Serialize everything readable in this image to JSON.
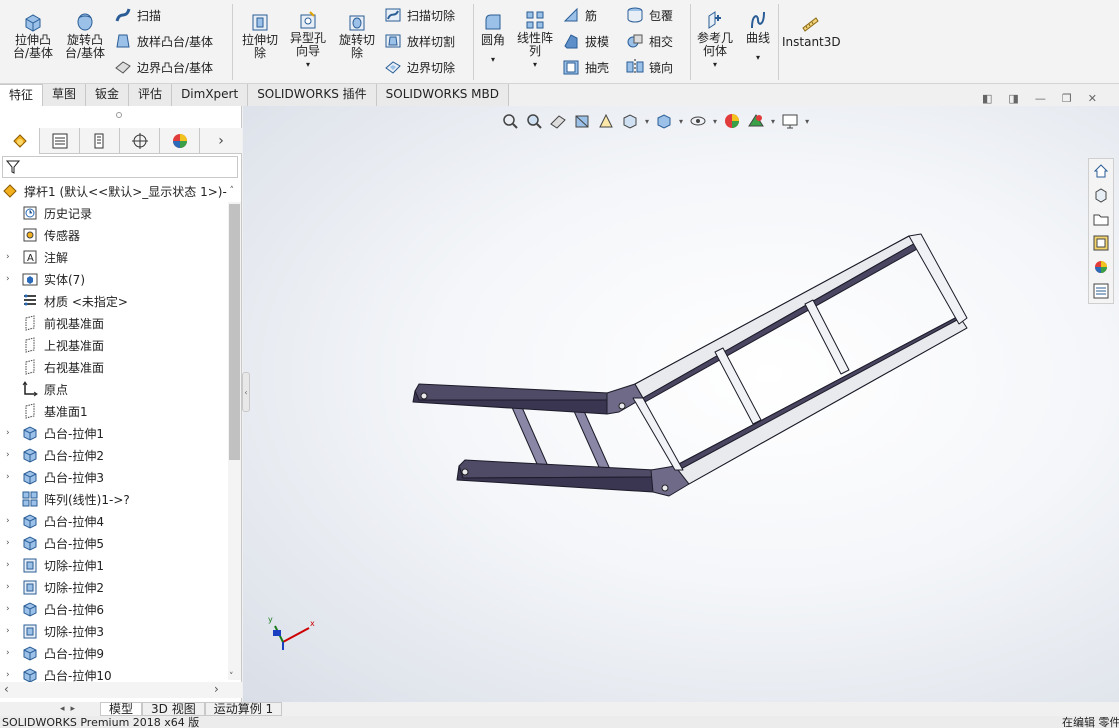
{
  "ribbon": {
    "extrude_boss": "拉伸凸\n台/基体",
    "revolve_boss": "旋转凸\n台/基体",
    "sweep": "扫描",
    "loft_boss": "放样凸台/基体",
    "boundary_boss": "边界凸台/基体",
    "extrude_cut": "拉伸切\n除",
    "hole_wizard": "异型孔\n向导",
    "revolve_cut": "旋转切\n除",
    "sweep_cut": "扫描切除",
    "loft_cut": "放样切割",
    "boundary_cut": "边界切除",
    "fillet": "圆角",
    "linear_pattern": "线性阵\n列",
    "rib": "筋",
    "draft": "拔模",
    "shell": "抽壳",
    "wrap": "包覆",
    "intersect": "相交",
    "mirror": "镜向",
    "ref_geometry": "参考几\n何体",
    "curves": "曲线",
    "instant3d": "Instant3D"
  },
  "tabs": [
    "特征",
    "草图",
    "钣金",
    "评估",
    "DimXpert",
    "SOLIDWORKS 插件",
    "SOLIDWORKS MBD"
  ],
  "tree": {
    "root": "撑杆1 (默认<<默认>_显示状态 1>)-",
    "items": [
      {
        "label": "历史记录",
        "icon": "history-icon",
        "exp": false
      },
      {
        "label": "传感器",
        "icon": "sensor-icon",
        "exp": false
      },
      {
        "label": "注解",
        "icon": "annotation-icon",
        "exp": true
      },
      {
        "label": "实体(7)",
        "icon": "solid-bodies-icon",
        "exp": true
      },
      {
        "label": "材质 <未指定>",
        "icon": "material-icon",
        "exp": false
      },
      {
        "label": "前视基准面",
        "icon": "plane-icon",
        "exp": false
      },
      {
        "label": "上视基准面",
        "icon": "plane-icon",
        "exp": false
      },
      {
        "label": "右视基准面",
        "icon": "plane-icon",
        "exp": false
      },
      {
        "label": "原点",
        "icon": "origin-icon",
        "exp": false
      },
      {
        "label": "基准面1",
        "icon": "plane-icon",
        "exp": false
      },
      {
        "label": "凸台-拉伸1",
        "icon": "boss-extrude-icon",
        "exp": true
      },
      {
        "label": "凸台-拉伸2",
        "icon": "boss-extrude-icon",
        "exp": true
      },
      {
        "label": "凸台-拉伸3",
        "icon": "boss-extrude-icon",
        "exp": true
      },
      {
        "label": "阵列(线性)1->?",
        "icon": "linear-pattern-icon",
        "exp": false
      },
      {
        "label": "凸台-拉伸4",
        "icon": "boss-extrude-icon",
        "exp": true
      },
      {
        "label": "凸台-拉伸5",
        "icon": "boss-extrude-icon",
        "exp": true
      },
      {
        "label": "切除-拉伸1",
        "icon": "cut-extrude-icon",
        "exp": true
      },
      {
        "label": "切除-拉伸2",
        "icon": "cut-extrude-icon",
        "exp": true
      },
      {
        "label": "凸台-拉伸6",
        "icon": "boss-extrude-icon",
        "exp": true
      },
      {
        "label": "切除-拉伸3",
        "icon": "cut-extrude-icon",
        "exp": true
      },
      {
        "label": "凸台-拉伸9",
        "icon": "boss-extrude-icon",
        "exp": true
      },
      {
        "label": "凸台-拉伸10",
        "icon": "boss-extrude-icon",
        "exp": true
      }
    ]
  },
  "bottom_tabs": [
    "模型",
    "3D 视图",
    "运动算例 1"
  ],
  "status": {
    "left": "SOLIDWORKS Premium 2018 x64 版",
    "right": "在编辑 零件"
  },
  "triad": {
    "x": "x",
    "y": "y"
  },
  "colors": {
    "accent": "#cc0000",
    "tree_icon": "#2a6ab8",
    "part_face": "#5a5470"
  }
}
